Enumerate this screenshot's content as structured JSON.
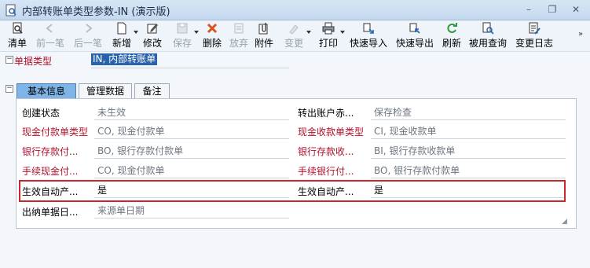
{
  "window": {
    "title": "内部转账单类型参数-IN (演示版)"
  },
  "toolbar": {
    "items": [
      {
        "label": "清单",
        "icon": "list-icon",
        "enabled": true
      },
      {
        "label": "前一笔",
        "icon": "arrow-left-icon",
        "enabled": false
      },
      {
        "label": "后一笔",
        "icon": "arrow-right-icon",
        "enabled": false
      },
      {
        "label": "新增",
        "icon": "new-document-icon",
        "enabled": true
      },
      {
        "label": "修改",
        "icon": "edit-icon",
        "enabled": true
      },
      {
        "label": "保存",
        "icon": "save-icon",
        "enabled": false
      },
      {
        "label": "删除",
        "icon": "delete-icon",
        "enabled": true
      },
      {
        "label": "放弃",
        "icon": "discard-icon",
        "enabled": false
      },
      {
        "label": "附件",
        "icon": "attachment-icon",
        "enabled": true
      },
      {
        "label": "变更",
        "icon": "change-icon",
        "enabled": false
      },
      {
        "label": "打印",
        "icon": "print-icon",
        "enabled": true
      },
      {
        "label": "快速导入",
        "icon": "import-icon",
        "enabled": true
      },
      {
        "label": "快速导出",
        "icon": "export-icon",
        "enabled": true
      },
      {
        "label": "刷新",
        "icon": "refresh-icon",
        "enabled": true
      },
      {
        "label": "被用查询",
        "icon": "usage-query-icon",
        "enabled": true
      },
      {
        "label": "变更日志",
        "icon": "change-log-icon",
        "enabled": true
      }
    ],
    "more": "»"
  },
  "document_type": {
    "label": "单据类型",
    "value": "IN, 内部转账单"
  },
  "tabs": [
    {
      "label": "基本信息",
      "active": true
    },
    {
      "label": "管理数据",
      "active": false
    },
    {
      "label": "备注",
      "active": false
    }
  ],
  "fields": {
    "left": [
      {
        "label": "创建状态",
        "value": "未生效",
        "required": false,
        "value_dark": false
      },
      {
        "label": "现金付款单类型",
        "value": "CO, 现金付款单",
        "required": true,
        "value_dark": false
      },
      {
        "label": "银行存款付...",
        "value": "BO, 银行存款付款单",
        "required": true,
        "value_dark": false
      },
      {
        "label": "手续现金付...",
        "value": "CO, 现金付款单",
        "required": true,
        "value_dark": false
      },
      {
        "label": "生效自动产...",
        "value": "是",
        "required": false,
        "value_dark": true
      },
      {
        "label": "出纳单据日...",
        "value": "来源单日期",
        "required": false,
        "value_dark": false
      }
    ],
    "right": [
      {
        "label": "转出账户赤...",
        "value": "保存检查",
        "required": false,
        "value_dark": false
      },
      {
        "label": "现金收款单类型",
        "value": "CI, 现金收款单",
        "required": true,
        "value_dark": false
      },
      {
        "label": "银行存款收...",
        "value": "BI, 银行存款收款单",
        "required": true,
        "value_dark": false
      },
      {
        "label": "手续银行付...",
        "value": "BO, 银行存款付款单",
        "required": true,
        "value_dark": false
      },
      {
        "label": "生效自动产...",
        "value": "是",
        "required": false,
        "value_dark": true
      }
    ]
  },
  "colors": {
    "required_label": "#b0122a",
    "active_tab": "#7fb4e6",
    "highlight_border": "#c8272e",
    "selection": "#2a63ad"
  }
}
